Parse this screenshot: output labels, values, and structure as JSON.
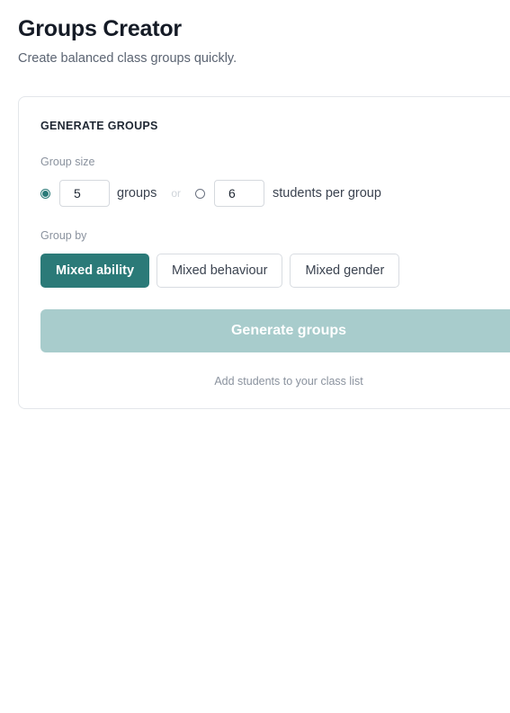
{
  "header": {
    "title": "Groups Creator",
    "subtitle": "Create balanced class groups quickly."
  },
  "card": {
    "heading": "GENERATE GROUPS",
    "group_size": {
      "label": "Group size",
      "groups_value": "5",
      "groups_unit": "groups",
      "or_text": "or",
      "students_value": "6",
      "students_unit": "students per group",
      "selected": "groups"
    },
    "group_by": {
      "label": "Group by",
      "options": [
        "Mixed ability",
        "Mixed behaviour",
        "Mixed gender"
      ],
      "selected": "Mixed ability"
    },
    "generate_label": "Generate groups",
    "hint": "Add students to your class list"
  },
  "colors": {
    "accent": "#2b7a78",
    "accent_disabled": "#a8cccc"
  }
}
